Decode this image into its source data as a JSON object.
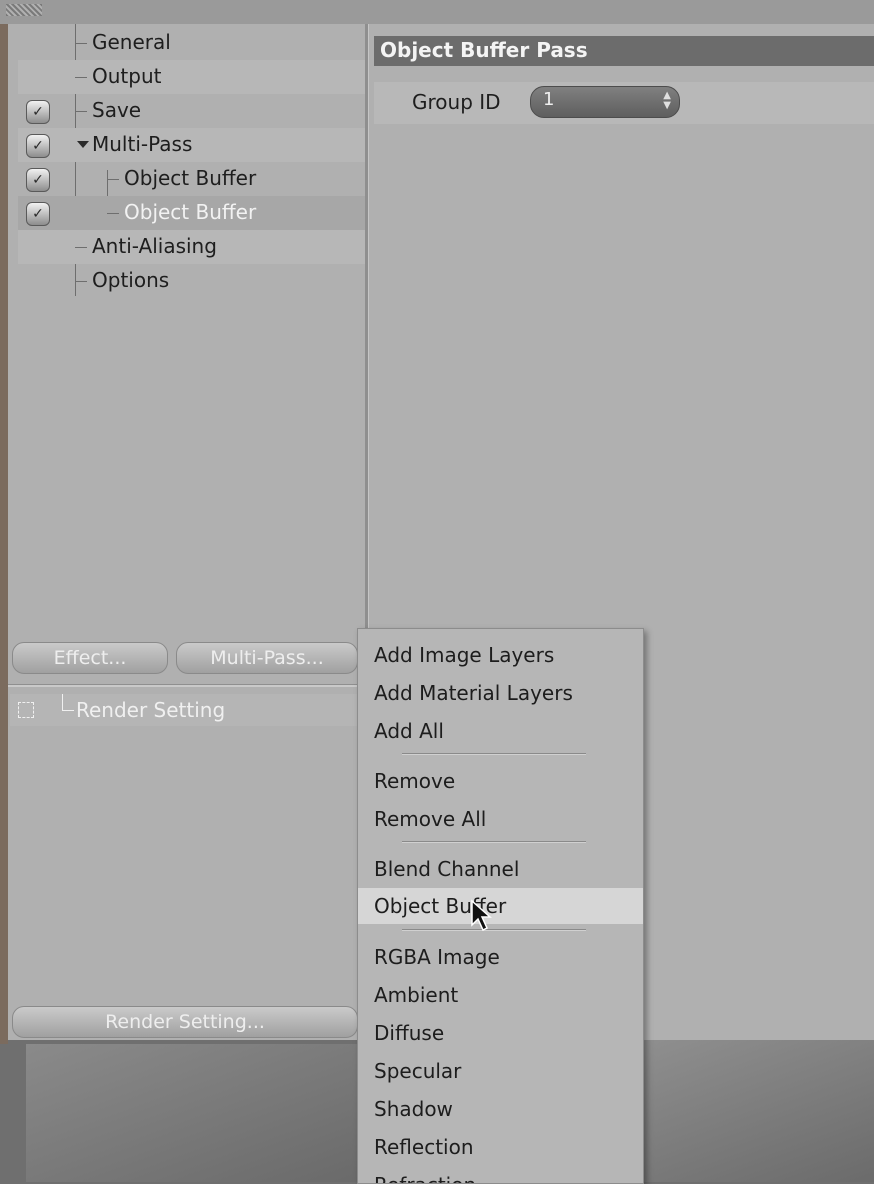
{
  "tree": {
    "items": [
      {
        "label": "General",
        "checked": false
      },
      {
        "label": "Output",
        "checked": false
      },
      {
        "label": "Save",
        "checked": true
      },
      {
        "label": "Multi-Pass",
        "checked": true,
        "expanded": true
      },
      {
        "label": "Object Buffer",
        "checked": true
      },
      {
        "label": "Object Buffer",
        "checked": true,
        "selected": true
      },
      {
        "label": "Anti-Aliasing",
        "checked": false
      },
      {
        "label": "Options",
        "checked": false
      }
    ]
  },
  "buttons": {
    "effect": "Effect...",
    "multipass": "Multi-Pass...",
    "render_setting": "Render Setting..."
  },
  "render_list": {
    "item": "Render Setting"
  },
  "attributes": {
    "header": "Object Buffer Pass",
    "group_id_label": "Group ID",
    "group_id_value": "1"
  },
  "menu": {
    "items": [
      "Add Image Layers",
      "Add Material Layers",
      "Add All",
      "Remove",
      "Remove All",
      "Blend Channel",
      "Object Buffer",
      "RGBA Image",
      "Ambient",
      "Diffuse",
      "Specular",
      "Shadow",
      "Reflection",
      "Refraction"
    ],
    "highlighted": "Object Buffer"
  },
  "colors": {
    "panel": "#b0b0b0",
    "header_bar": "#6c6c6c",
    "menu_bg": "#b6b6b6",
    "menu_highlight": "#d6d6d6"
  }
}
